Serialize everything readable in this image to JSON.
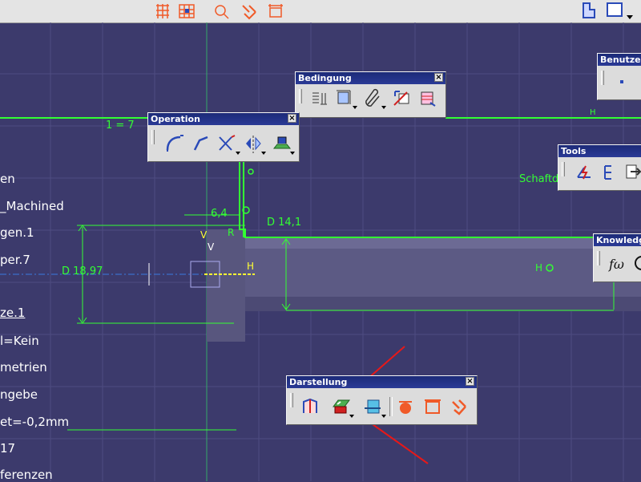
{
  "tree": {
    "items": [
      "en",
      "_Machined",
      "gen.1",
      "per.7",
      "ze.1",
      "l=Kein",
      "metrien",
      "ngebe",
      "et=-0,2mm",
      "17",
      "ferenzen"
    ]
  },
  "sketch": {
    "constraint_top": "1 = 7",
    "dim_64": "6,4",
    "dim_d141": "D 14,1",
    "dim_d1897": "D 18,97",
    "dim_r": "R",
    "label_h1": "H",
    "label_h2": "H",
    "label_h3": "H",
    "label_v1": "V",
    "label_v2": "V",
    "label_schaft": "Schaftd"
  },
  "toolbars": {
    "bedingung": {
      "title": "Bedingung"
    },
    "operation": {
      "title": "Operation"
    },
    "tools": {
      "title": "Tools"
    },
    "benutzer": {
      "title": "Benutzer"
    },
    "knowledge": {
      "title": "Knowledge"
    },
    "darstellung": {
      "title": "Darstellung"
    },
    "close_glyph": "×"
  },
  "colors": {
    "background": "#3c3a6c",
    "grid": "#4e4c82",
    "sketch_green": "#33ff33",
    "axis_yellow": "#ffff33",
    "annotation_red": "#e81818"
  }
}
